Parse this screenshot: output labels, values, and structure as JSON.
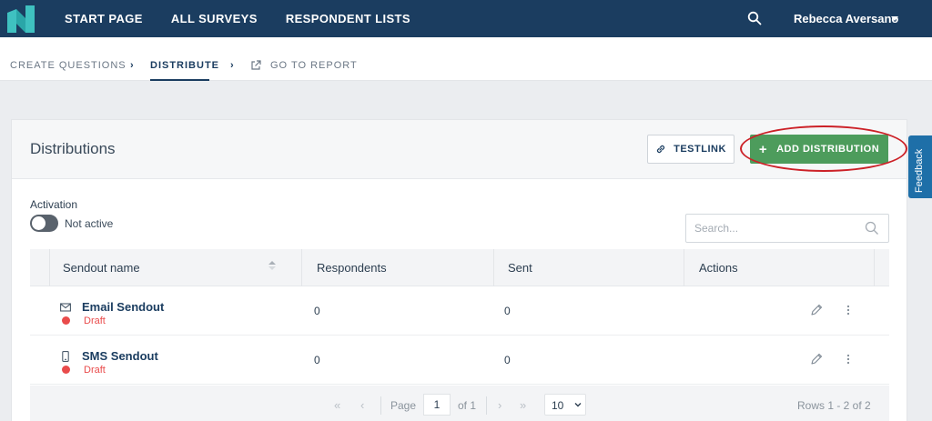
{
  "topnav": {
    "logo": "brand-logo-icon",
    "links": [
      "START PAGE",
      "ALL SURVEYS",
      "RESPONDENT LISTS"
    ],
    "user_name": "Rebecca Aversano"
  },
  "subnav": {
    "items": [
      "CREATE QUESTIONS",
      "DISTRIBUTE",
      "GO TO REPORT"
    ],
    "active": "DISTRIBUTE"
  },
  "panel": {
    "title": "Distributions",
    "testlink_label": "TESTLINK",
    "add_label": "ADD DISTRIBUTION",
    "activation_label": "Activation",
    "activation_status": "Not active",
    "search_placeholder": "Search..."
  },
  "table": {
    "headers": [
      "Sendout name",
      "Respondents",
      "Sent",
      "Actions"
    ],
    "rows": [
      {
        "icon": "email-icon",
        "name": "Email Sendout",
        "status": "Draft",
        "respondents": "0",
        "sent": "0"
      },
      {
        "icon": "mobile-phone-icon",
        "name": "SMS Sendout",
        "status": "Draft",
        "respondents": "0",
        "sent": "0"
      }
    ]
  },
  "pagination": {
    "page_label": "Page",
    "page": "1",
    "of_label": "of 1",
    "per_page": "10",
    "rows_label": "Rows 1 - 2 of 2"
  },
  "feedback_label": "Feedback",
  "colors": {
    "navy": "#1b3d60",
    "green": "#4d9c5c",
    "draft_red": "#e94b4b",
    "highlight": "#cc2127",
    "feedback_blue": "#1e6fa8"
  }
}
